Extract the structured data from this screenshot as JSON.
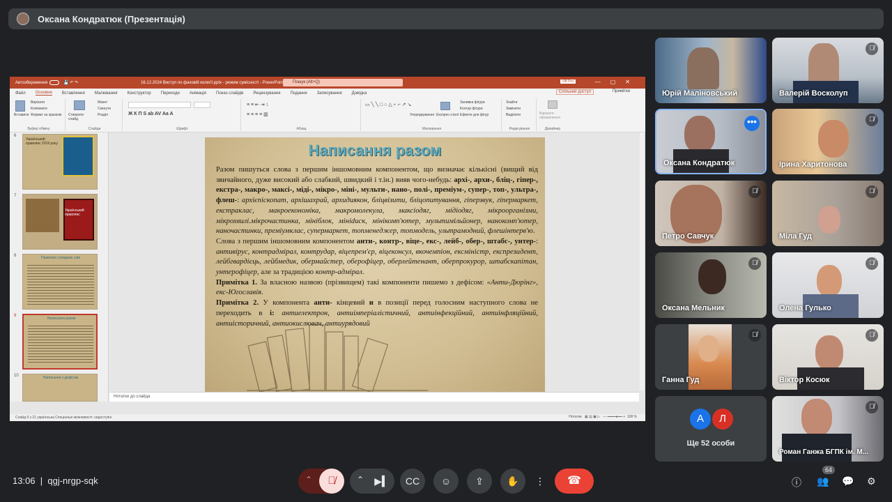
{
  "meeting": {
    "presenter_title": "Оксана Кондратюк (Презентація)",
    "time": "13:06",
    "code": "qgj-nrgp-sqk",
    "participants_count": "64"
  },
  "powerpoint": {
    "autosave": "Автозбереження",
    "doc_title": "16.12.2024 Виступ по фаховій колегії.pptx  -  режим сумісності  -  PowerPoint",
    "search": "Пошук (Alt+Q)",
    "menu": [
      "Файл",
      "Основне",
      "Вставлення",
      "Малювання",
      "Конструктор",
      "Переходи",
      "Анімація",
      "Показ слайдів",
      "Рецензування",
      "Подання",
      "Записування",
      "Довідка"
    ],
    "share": "Спільний доступ",
    "comments": "Примітки",
    "groups": [
      "Буфер обміну",
      "Слайди",
      "Шрифт",
      "Абзац",
      "Малювання",
      "Редагування",
      "Дизайнер"
    ],
    "ribbon_items": {
      "paste": "Вставити",
      "cut": "Вирізати",
      "copy": "Копіювати",
      "format": "Формат за зразком",
      "new_slide": "Створити слайд",
      "layout": "Макет",
      "reset": "Скинути",
      "section": "Розділ",
      "arrange": "Упорядкування",
      "styles": "Експрес-стилі",
      "fill": "Заливка фігури",
      "outline": "Контур фігури",
      "effects": "Ефекти для фігур",
      "find": "Знайти",
      "replace": "Замінити",
      "select": "Виділити",
      "designer": "Варіанти оформлення"
    },
    "thumbnails": [
      {
        "num": "6",
        "caption": "Український правопис 2019 року"
      },
      {
        "num": "7",
        "caption": "Український правопис"
      },
      {
        "num": "8",
        "caption": "Правопис складних слів"
      },
      {
        "num": "9",
        "caption": "Написання разом"
      },
      {
        "num": "10",
        "caption": "Написання з дефісом"
      }
    ],
    "notes": "Нотатки до слайда",
    "status_left": "Слайд 9 з 21    українська    Спеціальні можливості: недоступні",
    "status_right": "Нотатки",
    "zoom": "108 %"
  },
  "slide": {
    "title": "Написання разом",
    "p1_plain": "Разом пишуться слова з першим іншомовним компонентом, що визначає кількісні (вищий від звичайного, дуже високий або слабкий, швидкий і т.ін.) вияв чого-небудь: ",
    "p1_bold": "архі-, архи-, бліц-, гіпер-, екстра-, макро-, максі-, міді-, мікро-, міні-, мульти-, нано-, полі-, преміум-, супер-, топ-, ультра-, флеш-",
    "p1_sep": ": ",
    "p1_italic": "архієпіскопат, архішахрай, архидиякон, бліцвізити, бліцопитування, гіперзвук, гіпермаркет, екстраклас, макроекономіка, макромолекула, максіодяг, мідіодяг, мікроорганізми, мікрохвилі.мікрочастинка, мініблок, мініdиск, мінікомп'ютер, мультимільйонер, нанокомп'ютер, наночастинки, преміумклас, супермаркет, топменеджер, топмодель, ультрамодний, флешінтерв'ю",
    "p1_end": ".",
    "p2_plain": "Слова з першим іншомовним компонентом ",
    "p2_bold": "анти-, контр-, віце-, екс-, лейб-, обер-, штабс-, унтер-",
    "p2_sep": ": ",
    "p2_italic": "антивірус, контрадмірал, контрудар, віцепрем'єр, віцеконсул, вкочемпіон, ексміністр, експрезидент, лейбгвардієць, лейбмедик, обермайстер, оберофіцер, оберлейтенант, оберпрокурор, штабскапітан, унтерофіцер",
    "p2_mid": ", але за традицією ",
    "p2_italic2": "контр-адмірал",
    "p2_end": ".",
    "n1_label": "Примітка 1.",
    "n1_text": " За власною назвою (прізвищем) такі компоненти пишемо з дефісом: ",
    "n1_italic": "«Анти-Дюрінг», екс-Югославія",
    "n1_end": ".",
    "n2_label": "Примітка 2.",
    "n2_text1": " У компонента ",
    "n2_bold": "анти-",
    "n2_text2": " кінцевий ",
    "n2_bold2": "и",
    "n2_text3": " в позиції перед голосним наступного слова не переходить в ",
    "n2_bold3": "і:",
    "n2_italic": " антиелектрон, антиімперіалістичний, антиінфекційний, антиінфляційний, антиісторичний, антиокислювач, антиурядовий"
  },
  "participants": [
    {
      "name": "Юрій Маліновський",
      "muted": false
    },
    {
      "name": "Валерій Восколуп",
      "muted": true
    },
    {
      "name": "Оксана Кондратюк",
      "muted": false
    },
    {
      "name": "Ірина Харитонова",
      "muted": true
    },
    {
      "name": "Петро Савчук",
      "muted": true
    },
    {
      "name": "Міла Гуд",
      "muted": true
    },
    {
      "name": "Оксана Мельник",
      "muted": true
    },
    {
      "name": "Олена Гулько",
      "muted": true
    },
    {
      "name": "Ганна Гуд",
      "muted": true
    },
    {
      "name": "Віктор Косюк",
      "muted": true
    },
    {
      "name": "Роман Ганжа БГПК ім. М...",
      "muted": true
    }
  ],
  "others": {
    "label": "Ще 52 особи",
    "avatar1": "A",
    "avatar2": "Л",
    "avatar1_color": "#1a73e8",
    "avatar2_color": "#d93025"
  },
  "colors": {
    "ppt_accent": "#b7472a",
    "meet_bg": "#202124",
    "leave": "#ea4335",
    "slide_title": "#5fa8b9"
  }
}
